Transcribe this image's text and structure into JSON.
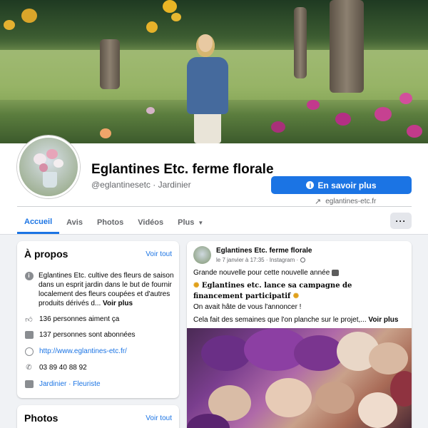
{
  "page": {
    "name": "Eglantines Etc. ferme florale",
    "handle": "@eglantinesetc · Jardinier",
    "cta_label": "En savoir plus",
    "website": "eglantines-etc.fr"
  },
  "tabs": [
    "Accueil",
    "Avis",
    "Photos",
    "Vidéos",
    "Plus"
  ],
  "more_button": "···",
  "about": {
    "title": "À propos",
    "see_all": "Voir tout",
    "description": "Eglantines Etc. cultive des fleurs de saison dans un esprit jardin dans le but de fournir localement des fleurs coupées et d'autres produits dérivés d...",
    "see_more": "Voir plus",
    "likes": "136 personnes aiment ça",
    "followers": "137 personnes sont abonnées",
    "url": "http://www.eglantines-etc.fr/",
    "phone": "03 89 40 88 92",
    "categories": "Jardinier · Fleuriste"
  },
  "photos": {
    "title": "Photos",
    "see_all": "Voir tout"
  },
  "post": {
    "author": "Eglantines Etc. ferme florale",
    "date": "le 7 janvier à 17:35 · Instagram ·",
    "line1": "Grande nouvelle pour cette nouvelle année",
    "bold_text": "Eglantines etc. lance sa campagne de financement participatif",
    "line2": "On avait hâte de vous l'annoncer !",
    "line3": "Cela fait des semaines que l'on planche sur le projet,...",
    "see_more": "Voir plus"
  },
  "icons": {
    "info": "info-icon",
    "like": "thumbs-up-icon",
    "follow": "checkbox-icon",
    "globe": "globe-icon",
    "phone": "phone-icon",
    "category": "folder-icon"
  },
  "colors": {
    "accent": "#1b74e4",
    "background": "#f0f2f5"
  }
}
